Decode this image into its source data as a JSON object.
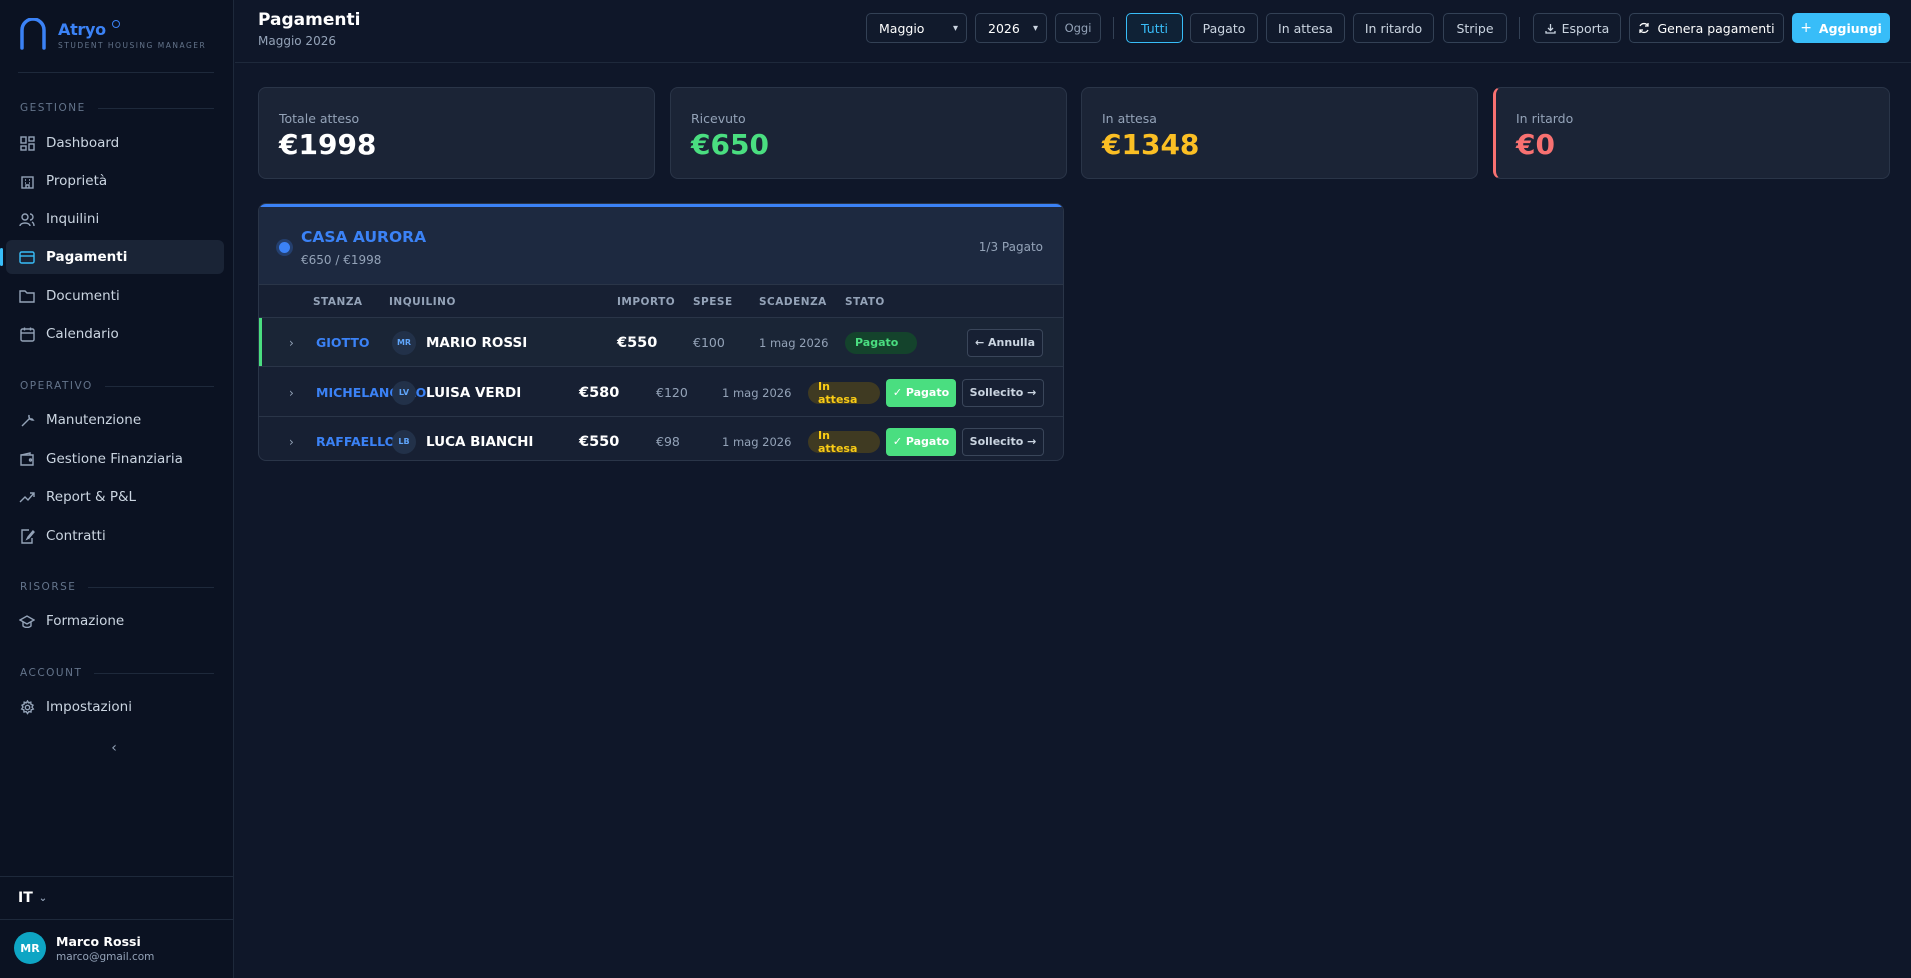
{
  "brand": {
    "name": "Atryo",
    "tagline": "STUDENT HOUSING MANAGER"
  },
  "sidebar": {
    "sections": [
      {
        "title": "GESTIONE"
      },
      {
        "title": "OPERATIVO"
      },
      {
        "title": "RISORSE"
      },
      {
        "title": "ACCOUNT"
      }
    ],
    "items": [
      {
        "label": "Dashboard"
      },
      {
        "label": "Proprietà"
      },
      {
        "label": "Inquilini"
      },
      {
        "label": "Pagamenti"
      },
      {
        "label": "Documenti"
      },
      {
        "label": "Calendario"
      },
      {
        "label": "Manutenzione"
      },
      {
        "label": "Gestione Finanziaria"
      },
      {
        "label": "Report & P&L"
      },
      {
        "label": "Contratti"
      },
      {
        "label": "Formazione"
      },
      {
        "label": "Impostazioni"
      }
    ],
    "active": "Pagamenti",
    "language": "IT",
    "user": {
      "initials": "MR",
      "name": "Marco Rossi",
      "email": "marco@gmail.com"
    }
  },
  "header": {
    "title": "Pagamenti",
    "subtitle": "Maggio 2026",
    "month_select": "Maggio",
    "year_select": "2026",
    "today_label": "Oggi",
    "filters": [
      "Tutti",
      "Pagato",
      "In attesa",
      "In ritardo",
      "Stripe"
    ],
    "active_filter": "Tutti",
    "export_label": "Esporta",
    "generate_label": "Genera pagamenti",
    "add_label": "Aggiungi"
  },
  "stats": [
    {
      "label": "Totale atteso",
      "value": "€1998",
      "color": "#ffffff"
    },
    {
      "label": "Ricevuto",
      "value": "€650",
      "color": "#4ade80"
    },
    {
      "label": "In attesa",
      "value": "€1348",
      "color": "#fbbf24"
    },
    {
      "label": "In ritardo",
      "value": "€0",
      "color": "#f87171"
    }
  ],
  "property": {
    "name": "CASA AURORA",
    "amounts": "€650 / €1998",
    "progress": "1/3 Pagato",
    "columns": [
      "STANZA",
      "INQUILINO",
      "IMPORTO",
      "SPESE",
      "SCADENZA",
      "STATO"
    ],
    "rows": [
      {
        "room": "GIOTTO",
        "initials": "MR",
        "tenant": "MARIO ROSSI",
        "amount": "€550",
        "fees": "€100",
        "due": "1 mag 2026",
        "status": "Pagato",
        "paid": true,
        "action": "← Annulla"
      },
      {
        "room": "MICHELANGELO",
        "initials": "LV",
        "tenant": "LUISA VERDI",
        "amount": "€580",
        "fees": "€120",
        "due": "1 mag 2026",
        "status": "In attesa",
        "paid": false,
        "pay_label": "✓ Pagato",
        "action": "Sollecito →"
      },
      {
        "room": "RAFFAELLO",
        "initials": "LB",
        "tenant": "LUCA BIANCHI",
        "amount": "€550",
        "fees": "€98",
        "due": "1 mag 2026",
        "status": "In attesa",
        "paid": false,
        "pay_label": "✓ Pagato",
        "action": "Sollecito →"
      }
    ]
  },
  "colors": {
    "accent": "#38bdf8",
    "brand": "#3b82f6",
    "success": "#4ade80",
    "warning": "#fbbf24",
    "danger": "#f87171"
  }
}
